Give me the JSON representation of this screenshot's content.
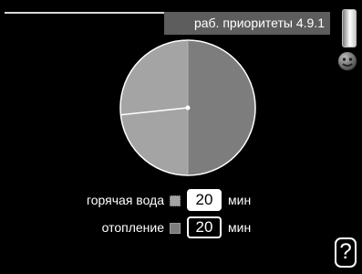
{
  "header": {
    "title": "раб. приоритеты 4.9.1"
  },
  "colors": {
    "hot_water": "#a4a4a4",
    "heating": "#7d7d7d"
  },
  "chart_data": {
    "type": "pie",
    "values": [
      20,
      20
    ],
    "series": [
      {
        "name": "горячая вода",
        "value": 20,
        "color": "#a4a4a4"
      },
      {
        "name": "отопление",
        "value": 20,
        "color": "#7d7d7d"
      }
    ],
    "pointer_minutes": 44
  },
  "rows": [
    {
      "label": "горячая вода",
      "value": "20",
      "unit": "мин"
    },
    {
      "label": "отопление",
      "value": "20",
      "unit": "мин"
    }
  ],
  "help": {
    "label": "?"
  },
  "icons": {
    "scroll": "scrollbar-thumb",
    "mood": "smiley-icon"
  }
}
